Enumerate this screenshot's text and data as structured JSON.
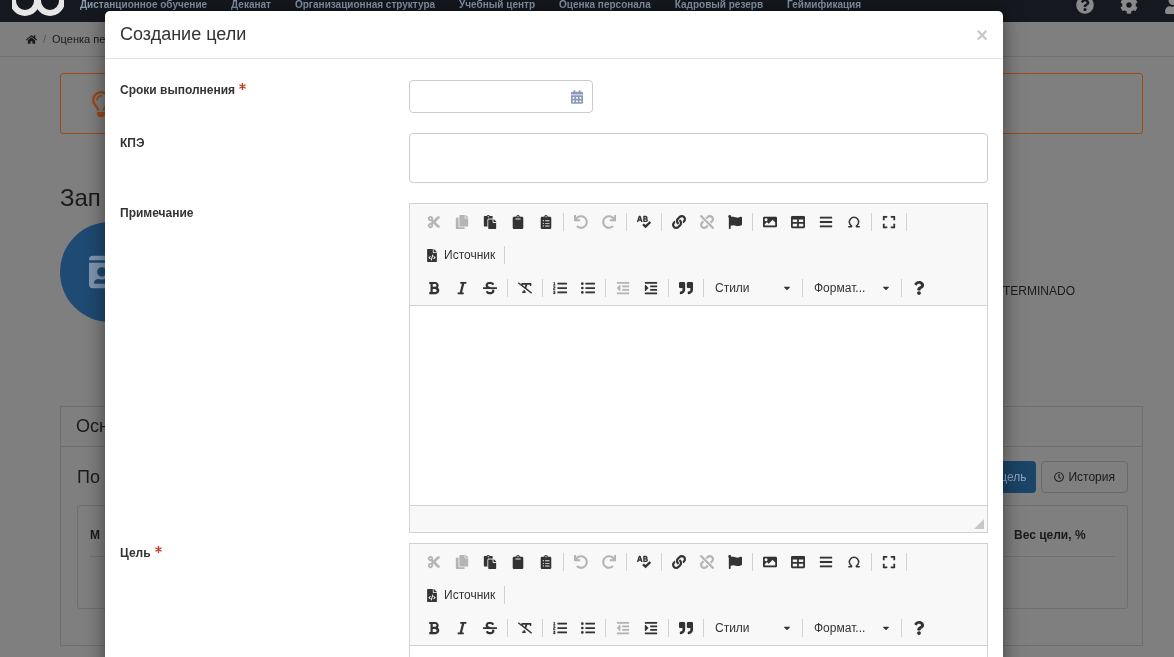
{
  "background": {
    "nav": [
      "Дистанционное обучение",
      "Деканат",
      "Организационная структура",
      "Учебный центр",
      "Оценка персонала",
      "Кадровый резерв",
      "Геймификация"
    ],
    "breadcrumb": {
      "separator": "/",
      "item": "Оценка пе"
    },
    "heading": "Зап",
    "status": "TERMINADO",
    "panel": {
      "tab": "Осн",
      "title": "По",
      "buttons": [
        {
          "label": "цель",
          "kind": "primary"
        },
        {
          "label": "История",
          "kind": "history"
        }
      ],
      "columns": [
        "М",
        "Вес цели, %"
      ]
    }
  },
  "modal": {
    "title": "Создание цели",
    "close": "×",
    "fields": [
      {
        "label": "Сроки выполнения",
        "required": true,
        "kind": "date"
      },
      {
        "label": "КПЭ",
        "required": false,
        "kind": "text"
      },
      {
        "label": "Примечание",
        "required": false,
        "kind": "editor",
        "resizable": true,
        "toolbar": [
          [
            {
              "kind": "cut",
              "disabled": true
            },
            {
              "kind": "copy",
              "disabled": true
            },
            {
              "kind": "paste",
              "disabled": false
            },
            {
              "kind": "paste-text",
              "disabled": false
            },
            {
              "kind": "paste-word",
              "disabled": false
            },
            {
              "kind": "separator"
            },
            {
              "kind": "undo",
              "disabled": true
            },
            {
              "kind": "redo",
              "disabled": true
            },
            {
              "kind": "separator"
            },
            {
              "kind": "spellcheck",
              "disabled": false
            },
            {
              "kind": "separator"
            },
            {
              "kind": "link",
              "disabled": false
            },
            {
              "kind": "unlink",
              "disabled": true
            },
            {
              "kind": "anchor",
              "disabled": false
            },
            {
              "kind": "separator"
            },
            {
              "kind": "image",
              "disabled": false
            },
            {
              "kind": "table",
              "disabled": false
            },
            {
              "kind": "rule",
              "disabled": false
            },
            {
              "kind": "special",
              "disabled": false
            },
            {
              "kind": "separator"
            },
            {
              "kind": "maximize",
              "disabled": false
            },
            {
              "kind": "separator"
            }
          ],
          [
            {
              "kind": "source",
              "label": "Источник",
              "disabled": false
            },
            {
              "kind": "separator"
            }
          ],
          [
            {
              "kind": "bold",
              "disabled": false
            },
            {
              "kind": "italic",
              "disabled": false
            },
            {
              "kind": "strike",
              "disabled": false
            },
            {
              "kind": "separator"
            },
            {
              "kind": "clear-format",
              "disabled": false
            },
            {
              "kind": "separator"
            },
            {
              "kind": "numbered-list",
              "disabled": false
            },
            {
              "kind": "bullet-list",
              "disabled": false
            },
            {
              "kind": "separator"
            },
            {
              "kind": "outdent",
              "disabled": true
            },
            {
              "kind": "indent",
              "disabled": false
            },
            {
              "kind": "separator"
            },
            {
              "kind": "quote",
              "disabled": false
            },
            {
              "kind": "separator"
            },
            {
              "kind": "combo",
              "label": "Стили",
              "disabled": false
            },
            {
              "kind": "separator"
            },
            {
              "kind": "combo",
              "label": "Формат...",
              "disabled": false
            },
            {
              "kind": "separator"
            },
            {
              "kind": "help",
              "disabled": false
            }
          ]
        ]
      },
      {
        "label": "Цель",
        "required": true,
        "kind": "editor",
        "toolbar": [
          [
            {
              "kind": "cut",
              "disabled": true
            },
            {
              "kind": "copy",
              "disabled": true
            },
            {
              "kind": "paste",
              "disabled": false
            },
            {
              "kind": "paste-text",
              "disabled": false
            },
            {
              "kind": "paste-word",
              "disabled": false
            },
            {
              "kind": "separator"
            },
            {
              "kind": "undo",
              "disabled": true
            },
            {
              "kind": "redo",
              "disabled": true
            },
            {
              "kind": "separator"
            },
            {
              "kind": "spellcheck",
              "disabled": false
            },
            {
              "kind": "separator"
            },
            {
              "kind": "link",
              "disabled": false
            },
            {
              "kind": "unlink",
              "disabled": true
            },
            {
              "kind": "anchor",
              "disabled": false
            },
            {
              "kind": "separator"
            },
            {
              "kind": "image",
              "disabled": false
            },
            {
              "kind": "table",
              "disabled": false
            },
            {
              "kind": "rule",
              "disabled": false
            },
            {
              "kind": "special",
              "disabled": false
            },
            {
              "kind": "separator"
            },
            {
              "kind": "maximize",
              "disabled": false
            },
            {
              "kind": "separator"
            }
          ],
          [
            {
              "kind": "source",
              "label": "Источник",
              "disabled": false
            },
            {
              "kind": "separator"
            }
          ],
          [
            {
              "kind": "bold",
              "disabled": false
            },
            {
              "kind": "italic",
              "disabled": false
            },
            {
              "kind": "strike",
              "disabled": false
            },
            {
              "kind": "separator"
            },
            {
              "kind": "clear-format",
              "disabled": false
            },
            {
              "kind": "separator"
            },
            {
              "kind": "numbered-list",
              "disabled": false
            },
            {
              "kind": "bullet-list",
              "disabled": false
            },
            {
              "kind": "separator"
            },
            {
              "kind": "outdent",
              "disabled": true
            },
            {
              "kind": "indent",
              "disabled": false
            },
            {
              "kind": "separator"
            },
            {
              "kind": "quote",
              "disabled": false
            },
            {
              "kind": "separator"
            },
            {
              "kind": "combo",
              "label": "Стили",
              "disabled": false
            },
            {
              "kind": "separator"
            },
            {
              "kind": "combo",
              "label": "Формат...",
              "disabled": false
            },
            {
              "kind": "separator"
            },
            {
              "kind": "help",
              "disabled": false
            }
          ]
        ]
      }
    ]
  }
}
